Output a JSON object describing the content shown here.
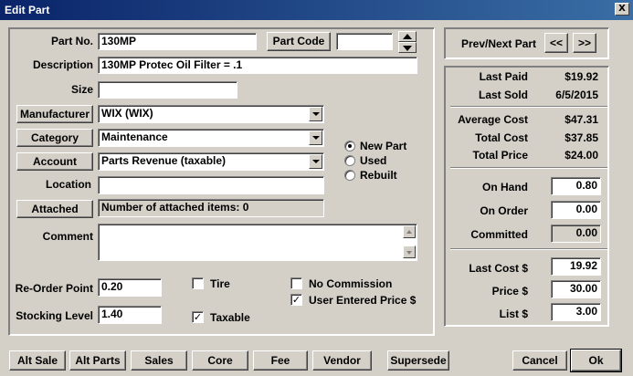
{
  "window": {
    "title": "Edit Part",
    "close_glyph": "X"
  },
  "form": {
    "part_no_label": "Part No.",
    "part_no_value": "130MP",
    "part_code_button": "Part Code",
    "part_code_value": "",
    "description_label": "Description",
    "description_value": "130MP Protec Oil Filter = .1",
    "size_label": "Size",
    "size_value": "",
    "manufacturer_button": "Manufacturer",
    "manufacturer_value": "WIX (WIX)",
    "category_button": "Category",
    "category_value": "Maintenance",
    "account_button": "Account",
    "account_value": "Parts Revenue (taxable)",
    "location_label": "Location",
    "location_value": "",
    "attached_button": "Attached",
    "attached_text": "Number of attached items: 0",
    "comment_label": "Comment",
    "comment_value": "",
    "reorder_label": "Re-Order Point",
    "reorder_value": "0.20",
    "stocking_label": "Stocking Level",
    "stocking_value": "1.40"
  },
  "condition": {
    "new_label": "New Part",
    "used_label": "Used",
    "rebuilt_label": "Rebuilt",
    "selected": "new"
  },
  "checks": {
    "tire_label": "Tire",
    "tire_checked": false,
    "taxable_label": "Taxable",
    "taxable_checked": true,
    "no_commission_label": "No Commission",
    "no_commission_checked": false,
    "user_price_label": "User Entered Price $",
    "user_price_checked": true,
    "check_glyph": "✓"
  },
  "nav": {
    "label": "Prev/Next Part",
    "prev": "<<",
    "next": ">>"
  },
  "stats": {
    "last_paid_label": "Last Paid",
    "last_paid": "$19.92",
    "last_sold_label": "Last Sold",
    "last_sold": "6/5/2015",
    "avg_cost_label": "Average Cost",
    "avg_cost": "$47.31",
    "total_cost_label": "Total Cost",
    "total_cost": "$37.85",
    "total_price_label": "Total Price",
    "total_price": "$24.00",
    "on_hand_label": "On Hand",
    "on_hand": "0.80",
    "on_order_label": "On Order",
    "on_order": "0.00",
    "committed_label": "Committed",
    "committed": "0.00",
    "last_cost_label": "Last Cost $",
    "last_cost": "19.92",
    "price_label": "Price $",
    "price": "30.00",
    "list_label": "List $",
    "list": "3.00"
  },
  "bottom_buttons": {
    "alt_sale": "Alt Sale",
    "alt_parts": "Alt Parts",
    "sales": "Sales",
    "core": "Core",
    "fee": "Fee",
    "vendor": "Vendor",
    "supersede": "Supersede",
    "cancel": "Cancel",
    "ok": "Ok"
  }
}
